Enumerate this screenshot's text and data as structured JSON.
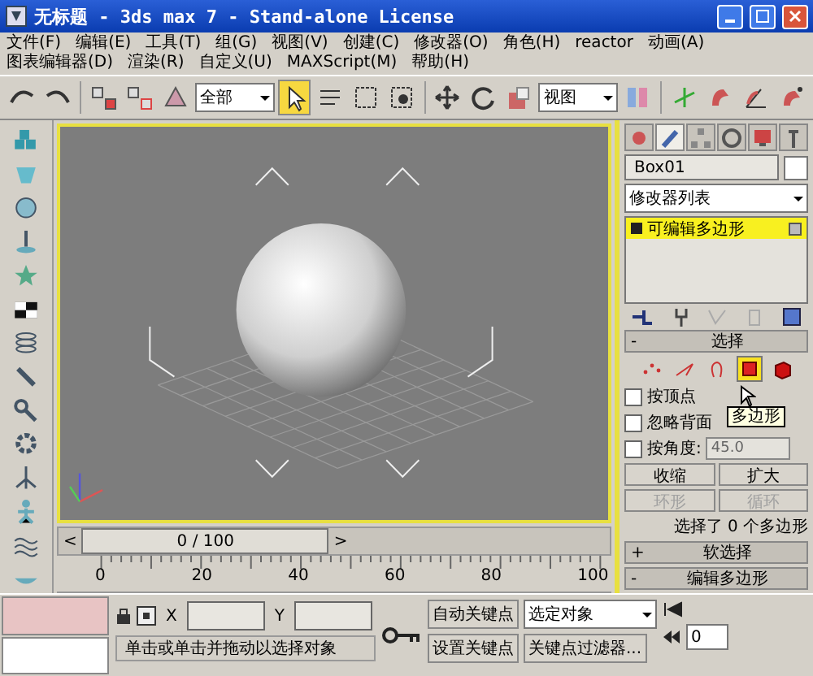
{
  "window": {
    "title": "无标题  - 3ds max 7  - Stand-alone License"
  },
  "menu": [
    "文件(F)",
    "编辑(E)",
    "工具(T)",
    "组(G)",
    "视图(V)",
    "创建(C)",
    "修改器(O)",
    "角色(H)",
    "reactor",
    "动画(A)",
    "图表编辑器(D)",
    "渲染(R)",
    "自定义(U)",
    "MAXScript(M)",
    "帮助(H)"
  ],
  "toolbar": [
    {
      "kind": "undo",
      "selected": false
    },
    {
      "kind": "redo",
      "selected": false
    },
    {
      "kind": "sep"
    },
    {
      "kind": "link",
      "selected": false
    },
    {
      "kind": "unlink",
      "selected": false
    },
    {
      "kind": "bind",
      "selected": false
    },
    {
      "kind": "dropdown",
      "value": "全部"
    },
    {
      "kind": "select",
      "selected": true
    },
    {
      "kind": "list",
      "selected": false
    },
    {
      "kind": "region",
      "selected": false
    },
    {
      "kind": "crossing",
      "selected": false
    },
    {
      "kind": "sep"
    },
    {
      "kind": "move",
      "selected": false
    },
    {
      "kind": "rotate",
      "selected": false
    },
    {
      "kind": "scale",
      "selected": false
    },
    {
      "kind": "dropdown",
      "value": "视图"
    },
    {
      "kind": "pivot",
      "selected": false
    },
    {
      "kind": "sep"
    },
    {
      "kind": "axis",
      "selected": false
    },
    {
      "kind": "snap",
      "selected": false
    },
    {
      "kind": "angle",
      "selected": false
    },
    {
      "kind": "percent",
      "selected": false
    }
  ],
  "panel": {
    "tabs": [
      {
        "kind": "create",
        "selected": false
      },
      {
        "kind": "modify",
        "selected": true
      },
      {
        "kind": "hierarchy",
        "selected": false
      },
      {
        "kind": "motion",
        "selected": false
      },
      {
        "kind": "display",
        "selected": false
      },
      {
        "kind": "utilities",
        "selected": false
      }
    ],
    "object_name": "Box01",
    "modifier_list": "修改器列表",
    "stack": [
      {
        "label": "可编辑多边形",
        "selected": true
      }
    ],
    "selection": {
      "toggle": "-",
      "title": "选择",
      "subobjects": [
        {
          "kind": "vertex",
          "selected": false
        },
        {
          "kind": "edge",
          "selected": false
        },
        {
          "kind": "border",
          "selected": false
        },
        {
          "kind": "polygon",
          "selected": true
        },
        {
          "kind": "element",
          "selected": false
        }
      ],
      "options": [
        {
          "label": "按顶点",
          "checked": false
        },
        {
          "label": "忽略背面",
          "checked": false
        },
        {
          "label": "按角度:",
          "checked": false,
          "value": "45.0"
        }
      ],
      "buttons": [
        {
          "label": "收缩",
          "disabled": false
        },
        {
          "label": "扩大",
          "disabled": false
        },
        {
          "label": "环形",
          "disabled": true
        },
        {
          "label": "循环",
          "disabled": true
        }
      ],
      "summary": "选择了 0 个多边形"
    },
    "tooltip": "多边形",
    "rollouts": [
      {
        "toggle": "+",
        "title": "软选择"
      },
      {
        "toggle": "-",
        "title": "编辑多边形"
      }
    ]
  },
  "timeline": {
    "prev": "<",
    "position": "0 / 100",
    "level": 0,
    "next": ">",
    "ruler_labels": [
      "0",
      "20",
      "40",
      "60",
      "80",
      "100"
    ]
  },
  "status": {
    "x_label": "X",
    "y_label": "Y",
    "prompt": "单击或单击并拖动以选择对象",
    "auto_key": "自动关键点",
    "key_mode": "选定对象",
    "set_key": "设置关键点",
    "key_filters": "关键点过滤器...",
    "frame": "0"
  }
}
